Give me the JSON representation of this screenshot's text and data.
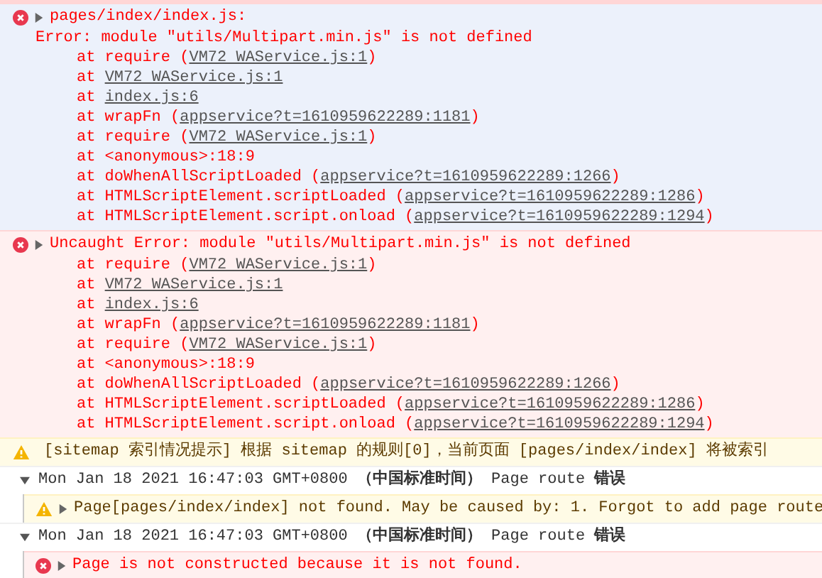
{
  "messages": [
    {
      "kind": "error",
      "highlighted": true,
      "expanded": false,
      "title": "pages/index/index.js:",
      "detail": "Error: module \"utils/Multipart.min.js\" is not defined",
      "stack": [
        {
          "text": "at require (",
          "link": "VM72 WAService.js:1",
          "end": ")"
        },
        {
          "text": "at",
          "link": "VM72 WAService.js:1"
        },
        {
          "text": "at",
          "link": "index.js:6"
        },
        {
          "text": "at wrapFn (",
          "link": "appservice?t=1610959622289:1181",
          "end": ")"
        },
        {
          "text": "at require (",
          "link": "VM72 WAService.js:1",
          "end": ")"
        },
        {
          "text": "at <anonymous>:18:9"
        },
        {
          "text": "at doWhenAllScriptLoaded (",
          "link": "appservice?t=1610959622289:1266",
          "end": ")"
        },
        {
          "text": "at HTMLScriptElement.scriptLoaded (",
          "link": "appservice?t=1610959622289:1286",
          "end": ")"
        },
        {
          "text": "at HTMLScriptElement.script.onload (",
          "link": "appservice?t=1610959622289:1294",
          "end": ")"
        }
      ]
    },
    {
      "kind": "error",
      "highlighted": false,
      "expanded": false,
      "title": "Uncaught Error: module \"utils/Multipart.min.js\" is not defined",
      "stack": [
        {
          "text": "at require (",
          "link": "VM72 WAService.js:1",
          "end": ")"
        },
        {
          "text": "at",
          "link": "VM72 WAService.js:1"
        },
        {
          "text": "at",
          "link": "index.js:6"
        },
        {
          "text": "at wrapFn (",
          "link": "appservice?t=1610959622289:1181",
          "end": ")"
        },
        {
          "text": "at require (",
          "link": "VM72 WAService.js:1",
          "end": ")"
        },
        {
          "text": "at <anonymous>:18:9"
        },
        {
          "text": "at doWhenAllScriptLoaded (",
          "link": "appservice?t=1610959622289:1266",
          "end": ")"
        },
        {
          "text": "at HTMLScriptElement.scriptLoaded (",
          "link": "appservice?t=1610959622289:1286",
          "end": ")"
        },
        {
          "text": "at HTMLScriptElement.script.onload (",
          "link": "appservice?t=1610959622289:1294",
          "end": ")"
        }
      ]
    },
    {
      "kind": "warning",
      "title": "[sitemap 索引情况提示] 根据 sitemap 的规则[0]，当前页面 [pages/index/index] 将被索引"
    },
    {
      "kind": "group",
      "expanded": true,
      "title": "Mon Jan 18 2021 16:47:03 GMT+0800 **（中国标准时间）** Page route **错误**",
      "children": [
        {
          "kind": "warning",
          "expanded": false,
          "title": "Page[pages/index/index] not found. May be caused by: 1. Forgot to add page route"
        }
      ]
    },
    {
      "kind": "group",
      "expanded": true,
      "title": "Mon Jan 18 2021 16:47:03 GMT+0800 **（中国标准时间）** Page route **错误**",
      "children": [
        {
          "kind": "error",
          "expanded": false,
          "title": "Page is not constructed because it is not found."
        }
      ]
    }
  ]
}
